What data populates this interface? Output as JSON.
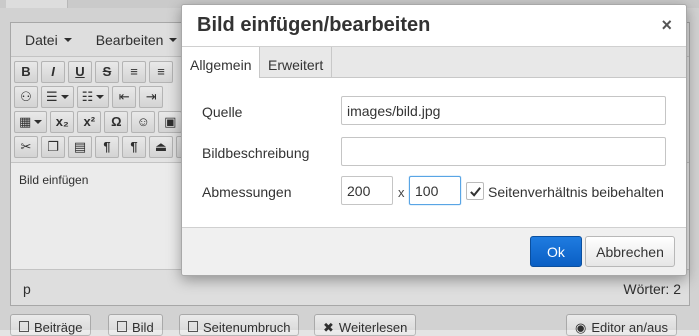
{
  "editor": {
    "menu": [
      {
        "label": "Datei"
      },
      {
        "label": "Bearbeiten"
      }
    ],
    "content_text": "Bild einfügen",
    "status_path": "p",
    "word_count": "Wörter: 2"
  },
  "bottom_buttons": [
    {
      "label": "Beiträge"
    },
    {
      "label": "Bild"
    },
    {
      "label": "Seitenumbruch"
    },
    {
      "label": "Weiterlesen"
    },
    {
      "label": "Editor an/aus"
    }
  ],
  "dialog": {
    "title": "Bild einfügen/bearbeiten",
    "close_glyph": "×",
    "tabs": [
      {
        "label": "Allgemein",
        "active": true
      },
      {
        "label": "Erweitert",
        "active": false
      }
    ],
    "fields": {
      "source_label": "Quelle",
      "source_value": "images/bild.jpg",
      "description_label": "Bildbeschreibung",
      "description_value": "",
      "dimensions_label": "Abmessungen",
      "width_value": "200",
      "times": "x",
      "height_value": "100",
      "constrain_label": "Seitenverhältnis beibehalten",
      "constrain_checked": true
    },
    "ok_label": "Ok",
    "cancel_label": "Abbrechen"
  },
  "colors": {
    "primary_button": "#0a5fc4",
    "focus_border": "#59a5e5"
  }
}
